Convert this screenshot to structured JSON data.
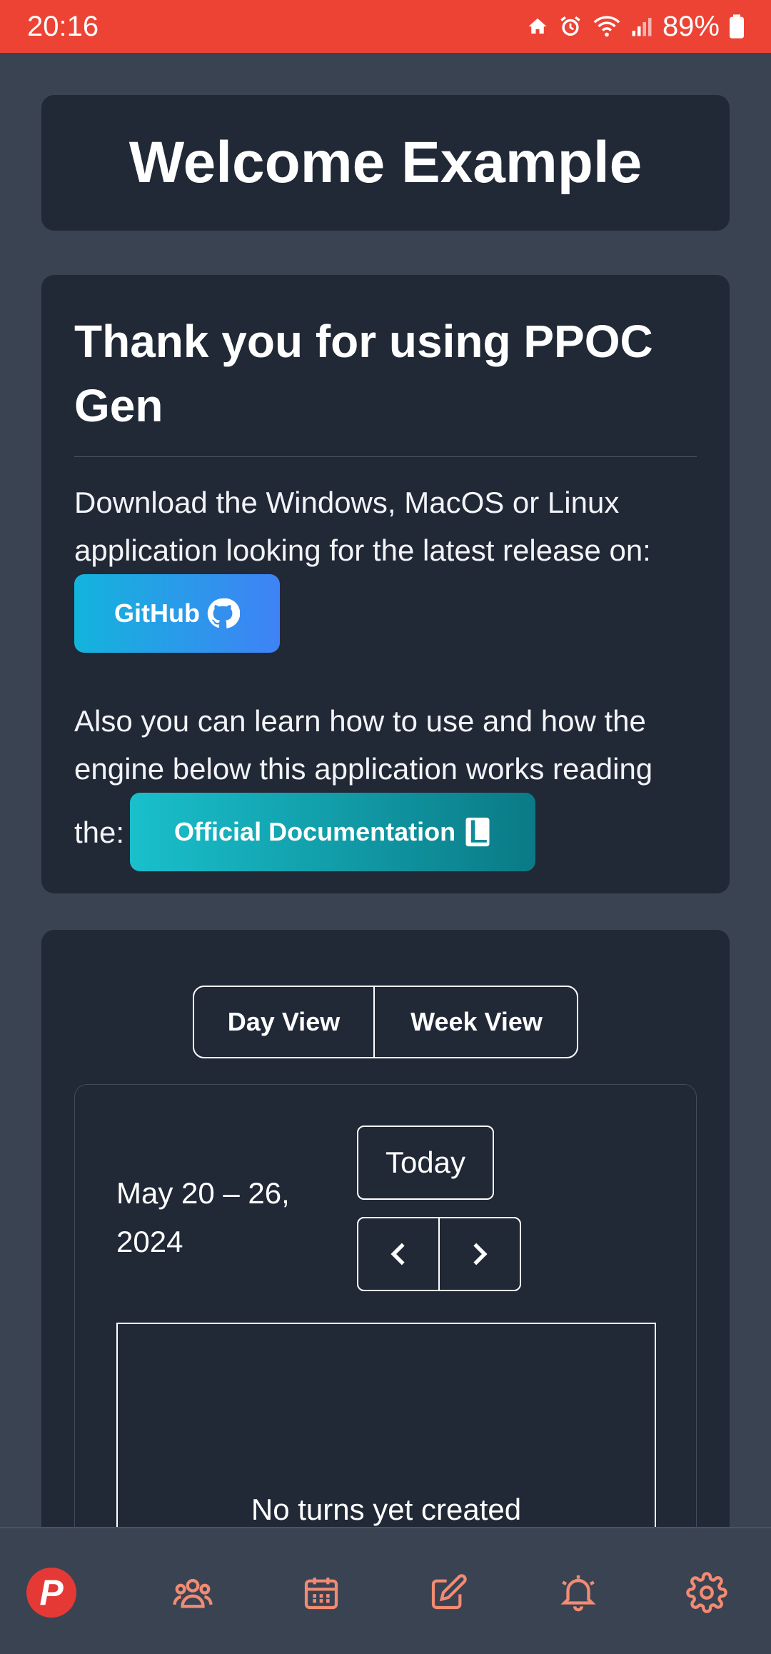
{
  "status_bar": {
    "time": "20:16",
    "battery": "89%"
  },
  "welcome": {
    "title": "Welcome Example"
  },
  "info": {
    "title": "Thank you for using PPOC Gen",
    "download_text": "Download the Windows, MacOS or Linux application looking for the latest release on:",
    "github_label": "GitHub",
    "docs_text": "Also you can learn how to use and how the engine below this application works reading the:",
    "docs_prefix": "the:",
    "docs_button_label": "Official Documentation"
  },
  "calendar": {
    "day_view_label": "Day View",
    "week_view_label": "Week View",
    "date_range": "May 20 – 26, 2024",
    "today_label": "Today",
    "empty_message": "No turns yet created"
  },
  "bottom_nav": {
    "logo_letter": "P",
    "items": [
      "people-icon",
      "calendar-icon",
      "edit-icon",
      "bell-icon",
      "settings-icon"
    ],
    "icon_color": "#f28b73"
  },
  "colors": {
    "status_bar": "#ec4335",
    "background": "#3a4352",
    "card": "#212836",
    "accent_logo": "#e53935"
  }
}
